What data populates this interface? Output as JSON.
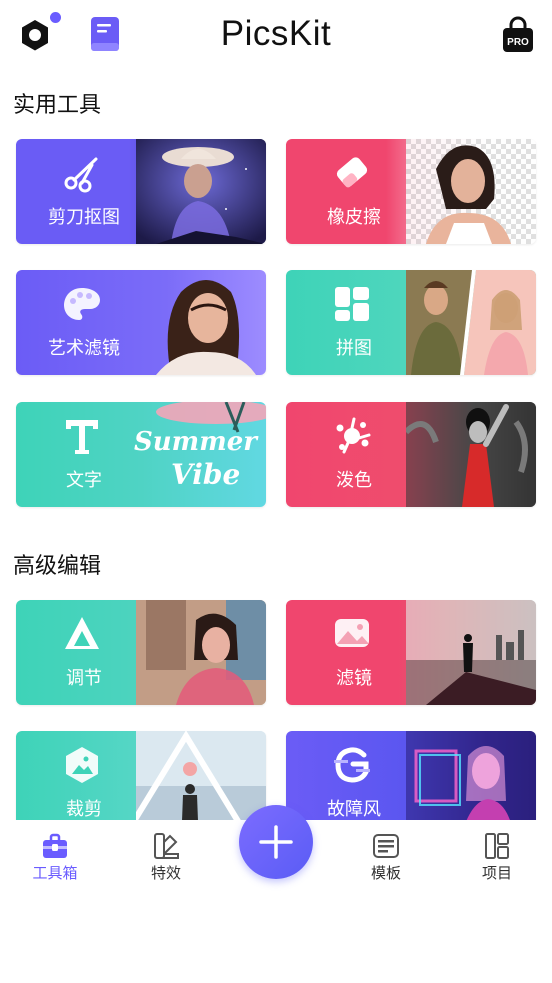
{
  "header": {
    "title": "PicsKit",
    "settings_icon": "hexagon-settings-icon",
    "book_icon": "book-icon",
    "pro_badge": "PRO"
  },
  "sections": {
    "practical_tools": "实用工具",
    "advanced_edit": "高级编辑"
  },
  "cards": {
    "cutout": "剪刀抠图",
    "eraser": "橡皮擦",
    "art_filter": "艺术滤镜",
    "collage": "拼图",
    "text": "文字",
    "splash": "泼色",
    "adjust": "调节",
    "filter": "滤镜",
    "crop": "裁剪",
    "glitch": "故障风"
  },
  "art_text": {
    "summer": "Summer",
    "vibe": "Vibe"
  },
  "tabs": {
    "toolbox": "工具箱",
    "effects": "特效",
    "templates": "模板",
    "projects": "项目"
  },
  "colors": {
    "accent": "#6a5cff",
    "purple": "#6b5cf6",
    "pink": "#f0466e",
    "teal": "#3ed3b8"
  }
}
